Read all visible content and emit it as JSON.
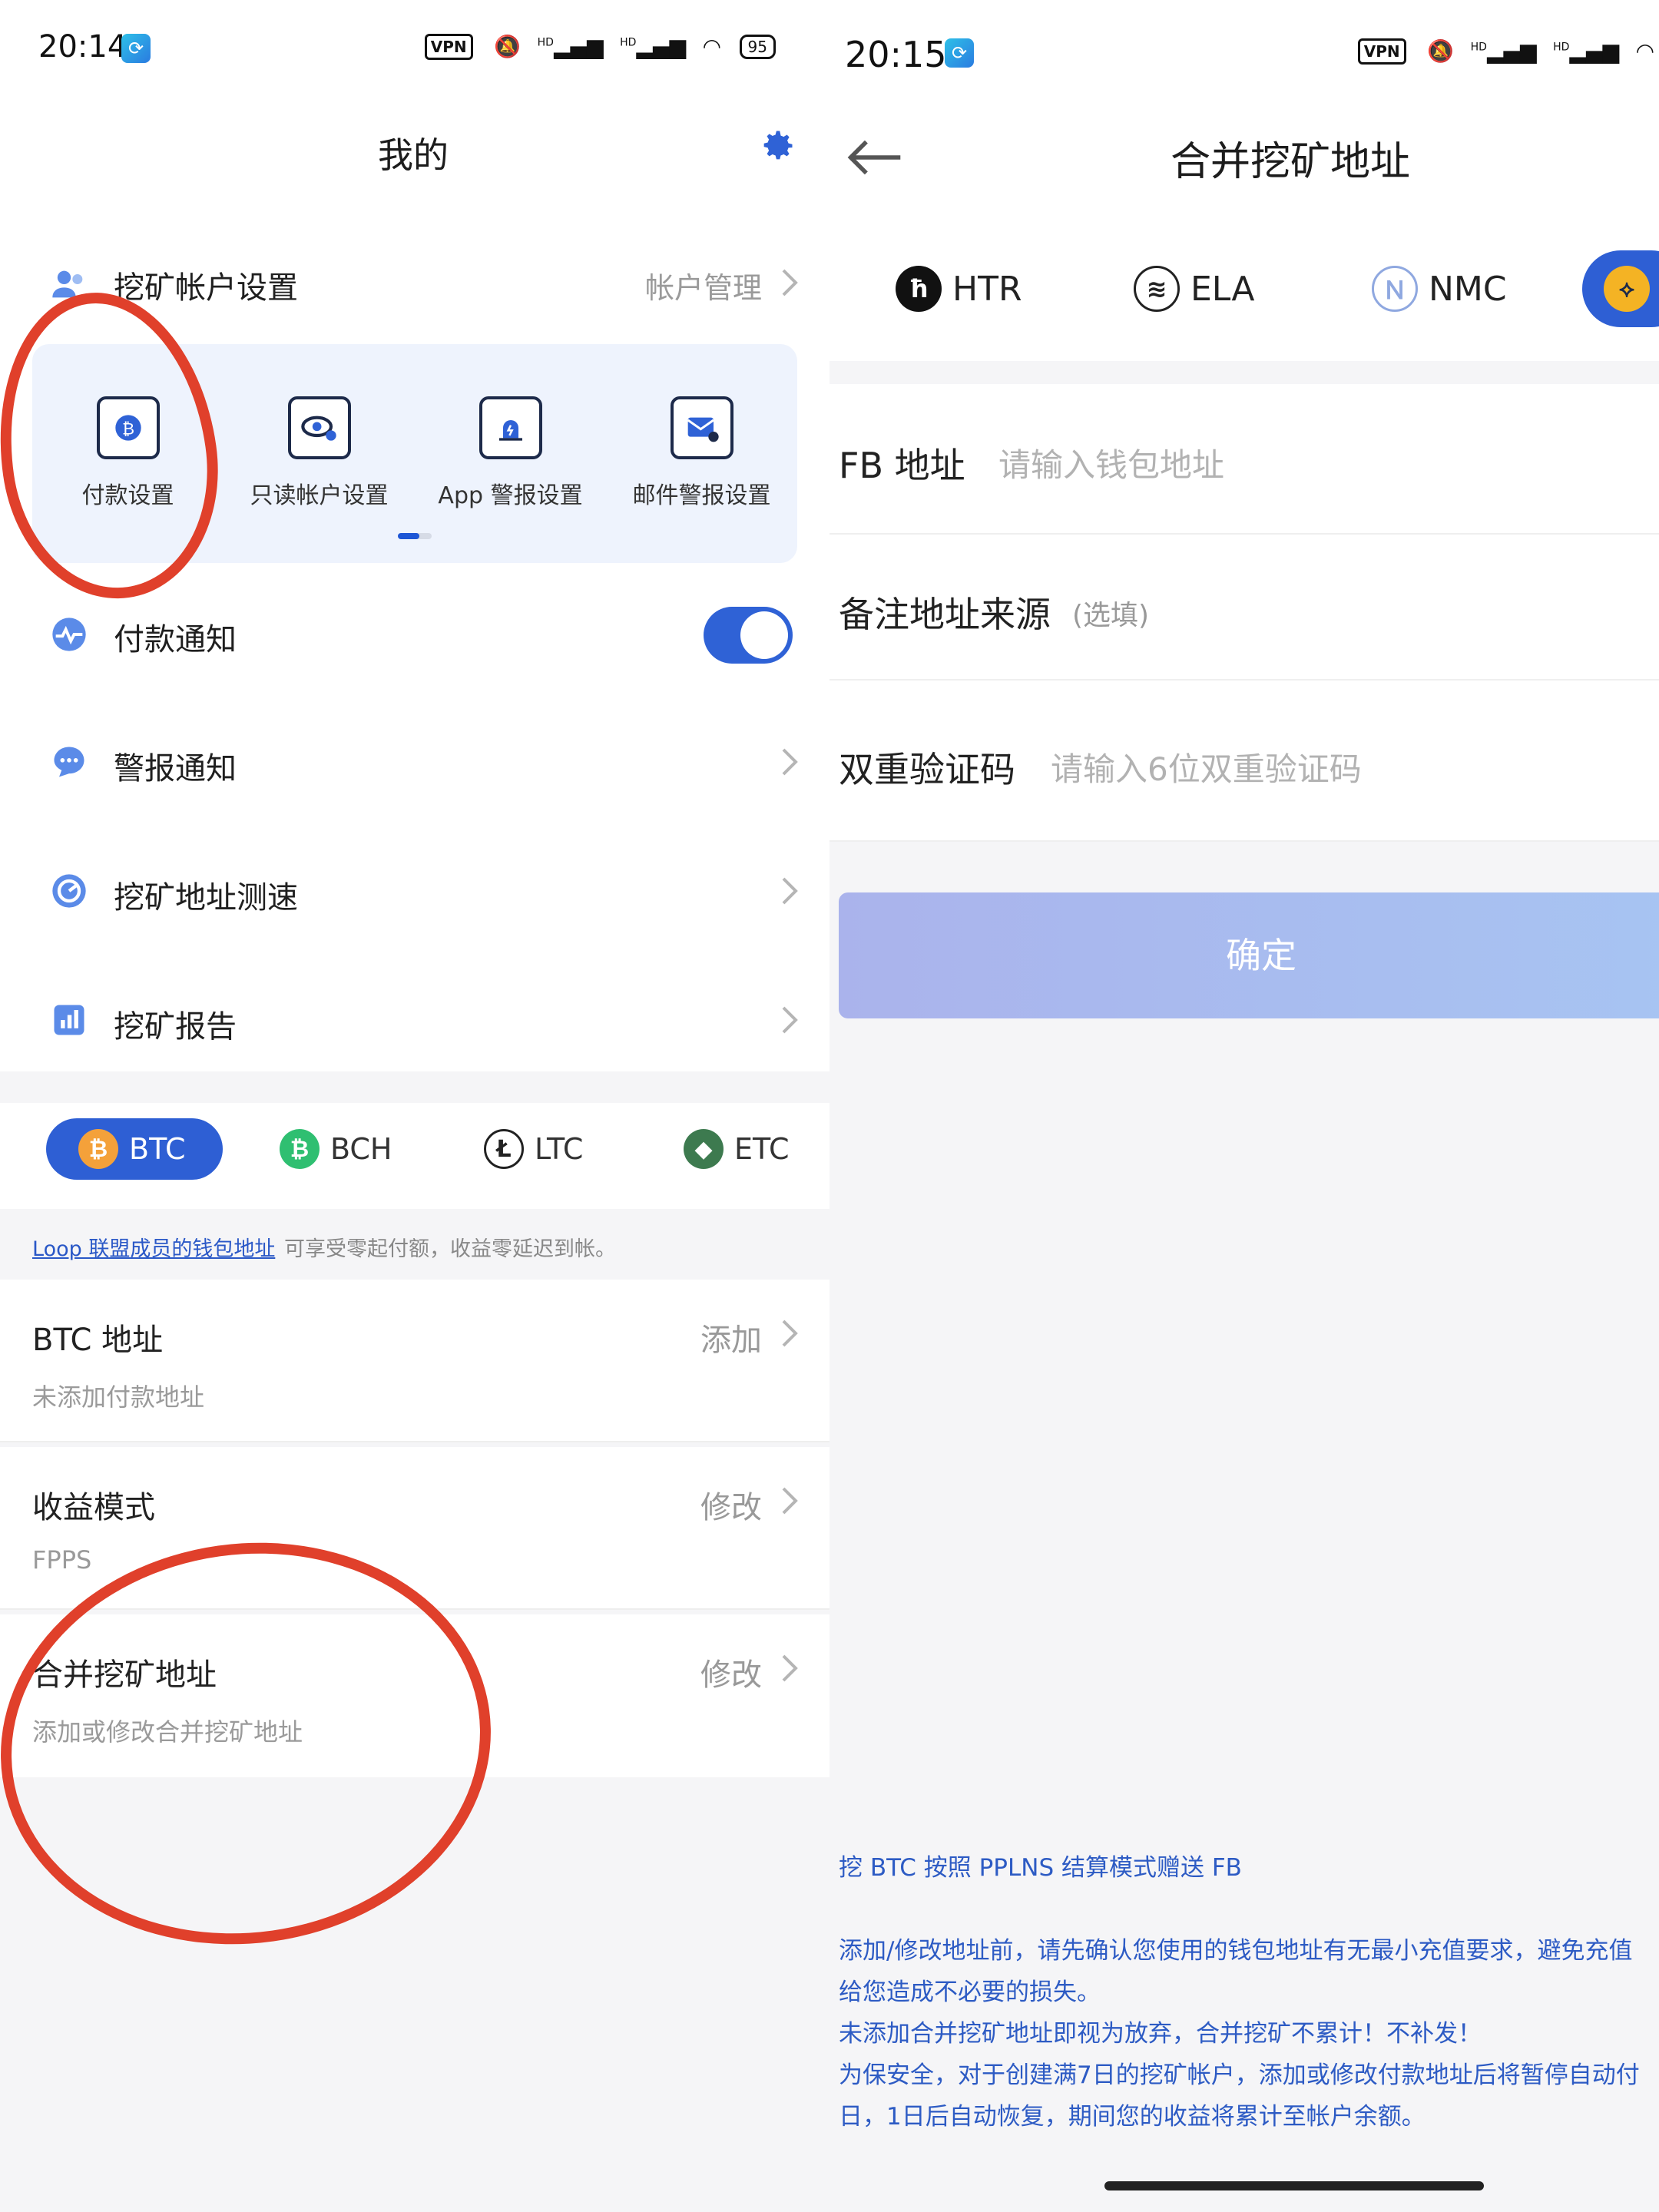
{
  "left": {
    "status": {
      "time": "20:14",
      "vpn": "VPN",
      "hd": "HD",
      "battery": "95"
    },
    "title": "我的",
    "account_row": {
      "label": "挖矿帐户设置",
      "right": "帐户管理"
    },
    "grid": [
      {
        "label": "付款设置"
      },
      {
        "label": "只读帐户设置"
      },
      {
        "label": "App 警报设置"
      },
      {
        "label": "邮件警报设置"
      }
    ],
    "payment_notice": {
      "label": "付款通知",
      "on": true
    },
    "alarm_notice": {
      "label": "警报通知"
    },
    "speed_test": {
      "label": "挖矿地址测速"
    },
    "report": {
      "label": "挖矿报告"
    },
    "coin_tabs": [
      {
        "label": "BTC",
        "color": "#f4a13a",
        "glyph": "₿"
      },
      {
        "label": "BCH",
        "color": "#2fbf71",
        "glyph": "₿"
      },
      {
        "label": "LTC",
        "color": "#ffffff",
        "glyph": "Ł"
      },
      {
        "label": "ETC",
        "color": "#3d7a4f",
        "glyph": "◆"
      }
    ],
    "loop_note": {
      "link": "Loop 联盟成员的钱包地址",
      "tail": "可享受零起付额，收益零延迟到帐。"
    },
    "btc_address": {
      "title": "BTC 地址",
      "sub": "未添加付款地址",
      "action": "添加"
    },
    "income_mode": {
      "title": "收益模式",
      "sub": "FPPS",
      "action": "修改"
    },
    "merged_mining": {
      "title": "合并挖矿地址",
      "sub": "添加或修改合并挖矿地址",
      "action": "修改"
    }
  },
  "right": {
    "status": {
      "time": "20:15",
      "vpn": "VPN",
      "hd": "HD"
    },
    "title": "合并挖矿地址",
    "coins": [
      {
        "label": "HTR",
        "glyph": "ħ"
      },
      {
        "label": "ELA",
        "glyph": "≋"
      },
      {
        "label": "NMC",
        "glyph": "Ｎ"
      }
    ],
    "fb_field": {
      "label": "FB 地址",
      "placeholder": "请输入钱包地址"
    },
    "memo_field": {
      "label": "备注地址来源",
      "placeholder": "(选填)"
    },
    "otp_field": {
      "label": "双重验证码",
      "placeholder": "请输入6位双重验证码"
    },
    "confirm": "确定",
    "notes": [
      "挖 BTC 按照 PPLNS 结算模式赠送 FB",
      "添加/修改地址前，请先确认您使用的钱包地址有无最小充值要求，避免充值",
      "给您造成不必要的损失。",
      "未添加合并挖矿地址即视为放弃，合并挖矿不累计！不补发！",
      "为保安全，对于创建满7日的挖矿帐户，添加或修改付款地址后将暂停自动付",
      "日，1日后自动恢复，期间您的收益将累计至帐户余额。"
    ]
  },
  "colors": {
    "accent": "#2e5fd4",
    "annotation": "#e0402b",
    "link": "#2a58c7"
  }
}
